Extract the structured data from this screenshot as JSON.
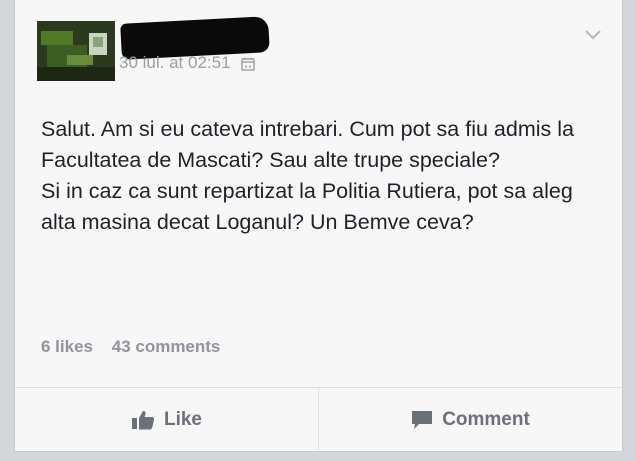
{
  "post": {
    "timestamp": "30 iul. at 02:51",
    "body_lines": [
      "Salut. Am si eu cateva intrebari. Cum pot sa fiu admis la Facultatea de Mascati? Sau alte trupe speciale?",
      "Si in caz ca sunt repartizat la Politia Rutiera, pot sa aleg alta masina decat Loganul? Un Bemve ceva?"
    ],
    "likes": "6 likes",
    "comments": "43 comments"
  },
  "actions": {
    "like_label": "Like",
    "comment_label": "Comment"
  },
  "icons": {
    "options": "chevron-down-icon",
    "audience": "calendar-icon",
    "like": "thumbs-up-icon",
    "comment": "speech-bubble-icon"
  },
  "colors": {
    "text": "#1d2129",
    "meta": "#90949c",
    "action": "#6b7079"
  }
}
